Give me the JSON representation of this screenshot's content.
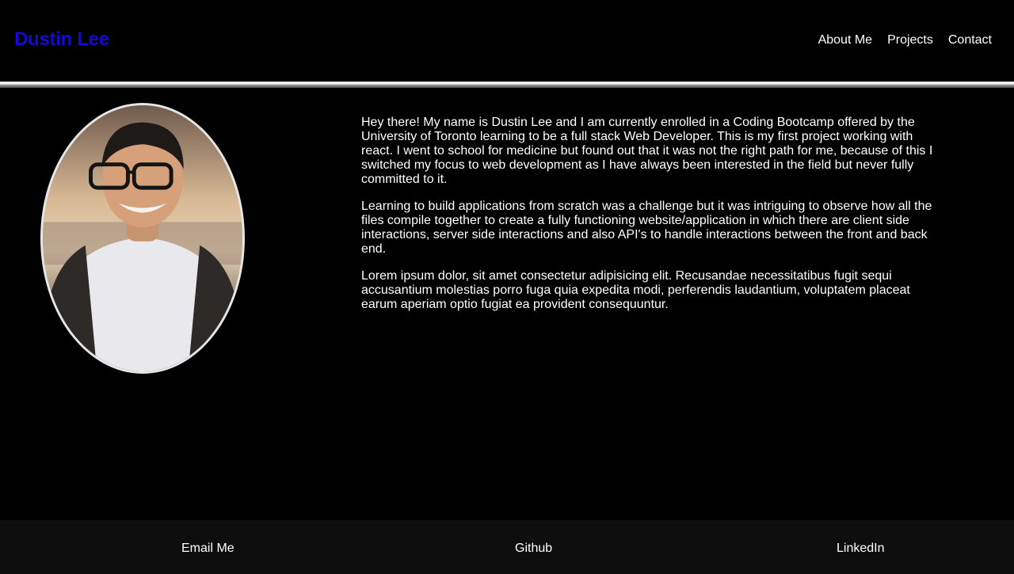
{
  "header": {
    "brand": "Dustin Lee",
    "brand_color": "#1707d6",
    "nav": [
      "About Me",
      "Projects",
      "Contact"
    ]
  },
  "portrait": {
    "alt_kind": "profile-photo"
  },
  "about": {
    "paragraphs": [
      "Hey there! My name is Dustin Lee and I am currently enrolled in a Coding Bootcamp offered by the University of Toronto learning to be a full stack Web Developer. This is my first project working with react. I went to school for medicine but found out that it was not the right path for me, because of this I switched my focus to web development as I have always been interested in the field but never fully committed to it.",
      "Learning to build applications from scratch was a challenge but it was intriguing to observe how all the files compile together to create a fully functioning website/application in which there are client side interactions, server side interactions and also API's to handle interactions between the front and back end.",
      "Lorem ipsum dolor, sit amet consectetur adipisicing elit. Recusandae necessitatibus fugit sequi accusantium molestias porro fuga quia expedita modi, perferendis laudantium, voluptatem placeat earum aperiam optio fugiat ea provident consequuntur."
    ]
  },
  "footer": {
    "links": [
      "Email Me",
      "Github",
      "LinkedIn"
    ]
  }
}
